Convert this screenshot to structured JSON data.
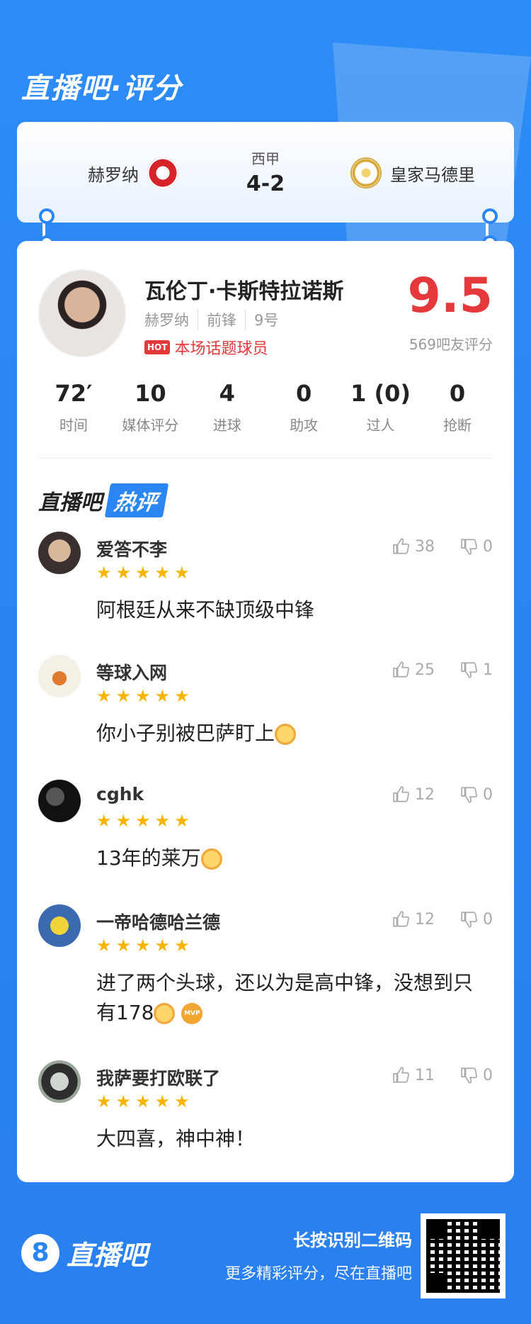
{
  "header": {
    "title": "直播吧·评分"
  },
  "match": {
    "league": "西甲",
    "score": "4-2",
    "home_team": "赫罗纳",
    "away_team": "皇家马德里"
  },
  "player": {
    "name": "瓦伦丁·卡斯特拉诺斯",
    "team": "赫罗纳",
    "position": "前锋",
    "number": "9号",
    "hot_badge": "HOT",
    "hot_label": "本场话题球员",
    "rating": "9.5",
    "rating_count": "569吧友评分",
    "stats": [
      {
        "value": "72′",
        "label": "时间"
      },
      {
        "value": "10",
        "label": "媒体评分"
      },
      {
        "value": "4",
        "label": "进球"
      },
      {
        "value": "0",
        "label": "助攻"
      },
      {
        "value": "1 (0)",
        "label": "过人"
      },
      {
        "value": "0",
        "label": "抢断"
      }
    ]
  },
  "hot_comments": {
    "title_prefix": "直播吧",
    "title_tag": "热评",
    "items": [
      {
        "user": "爱答不李",
        "stars": "★★★★★",
        "text": "阿根廷从来不缺顶级中锋",
        "likes": "38",
        "dislikes": "0"
      },
      {
        "user": "等球入网",
        "stars": "★★★★★",
        "text": "你小子别被巴萨盯上",
        "likes": "25",
        "dislikes": "1"
      },
      {
        "user": "cghk",
        "stars": "★★★★★",
        "text": "13年的莱万",
        "likes": "12",
        "dislikes": "0"
      },
      {
        "user": "一帝哈德哈兰德",
        "stars": "★★★★★",
        "text": "进了两个头球，还以为是高中锋，没想到只有178",
        "likes": "12",
        "dislikes": "0"
      },
      {
        "user": "我萨要打欧联了",
        "stars": "★★★★★",
        "text": "大四喜，神中神！",
        "likes": "11",
        "dislikes": "0"
      }
    ]
  },
  "footer": {
    "logo_number": "8",
    "logo_text": "直播吧",
    "cta_main": "长按识别二维码",
    "cta_sub": "更多精彩评分，尽在直播吧"
  },
  "colors": {
    "accent": "#2a86f2",
    "rating": "#e5383b",
    "star": "#f7b500"
  }
}
